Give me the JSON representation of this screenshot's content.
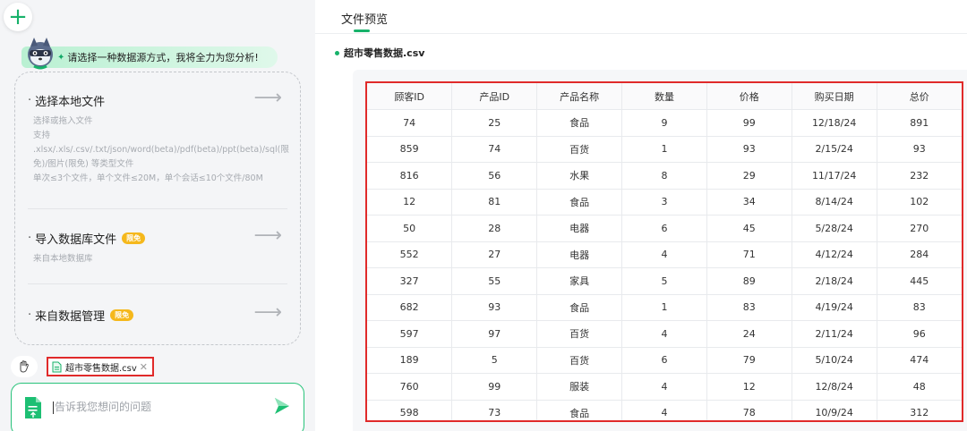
{
  "left": {
    "greeting": "请选择一种数据源方式，我将全力为您分析!",
    "sources": [
      {
        "title": "选择本地文件",
        "desc_lines": [
          "选择或拖入文件",
          "支持",
          ".xlsx/.xls/.csv/.txt/json/word(beta)/pdf(beta)/ppt(beta)/sql(限",
          "免)/图片(限免) 等类型文件",
          "单次≤3个文件，单个文件≤20M，单个会话≤10个文件/80M"
        ]
      },
      {
        "title": "导入数据库文件",
        "badge": "限免",
        "desc_lines": [
          "来自本地数据库"
        ]
      },
      {
        "title": "来自数据管理",
        "badge": "限免",
        "desc_lines": []
      }
    ],
    "attached_file": "超市零售数据.csv",
    "input_placeholder": "告诉我您想问的问题"
  },
  "right": {
    "tab": "文件预览",
    "file_name": "超市零售数据.csv",
    "columns": [
      "顾客ID",
      "产品ID",
      "产品名称",
      "数量",
      "价格",
      "购买日期",
      "总价"
    ],
    "rows": [
      [
        "74",
        "25",
        "食品",
        "9",
        "99",
        "12/18/24",
        "891"
      ],
      [
        "859",
        "74",
        "百货",
        "1",
        "93",
        "2/15/24",
        "93"
      ],
      [
        "816",
        "56",
        "水果",
        "8",
        "29",
        "11/17/24",
        "232"
      ],
      [
        "12",
        "81",
        "食品",
        "3",
        "34",
        "8/14/24",
        "102"
      ],
      [
        "50",
        "28",
        "电器",
        "6",
        "45",
        "5/28/24",
        "270"
      ],
      [
        "552",
        "27",
        "电器",
        "4",
        "71",
        "4/12/24",
        "284"
      ],
      [
        "327",
        "55",
        "家具",
        "5",
        "89",
        "2/18/24",
        "445"
      ],
      [
        "682",
        "93",
        "食品",
        "1",
        "83",
        "4/19/24",
        "83"
      ],
      [
        "597",
        "97",
        "百货",
        "4",
        "24",
        "2/11/24",
        "96"
      ],
      [
        "189",
        "5",
        "百货",
        "6",
        "79",
        "5/10/24",
        "474"
      ],
      [
        "760",
        "99",
        "服装",
        "4",
        "12",
        "12/8/24",
        "48"
      ],
      [
        "598",
        "73",
        "食品",
        "4",
        "78",
        "10/9/24",
        "312"
      ]
    ]
  },
  "colors": {
    "accent": "#17b26a",
    "highlight": "#e02a2a",
    "badge": "#f5b81c"
  }
}
